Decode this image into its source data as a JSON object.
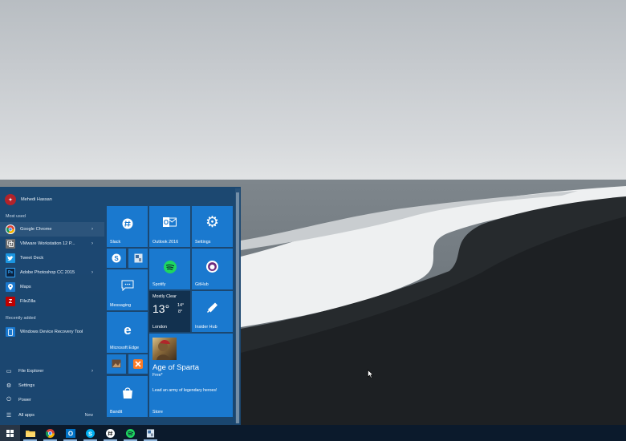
{
  "user": {
    "name": "Mehedi Hassan"
  },
  "most_used": {
    "header": "Most used",
    "items": [
      {
        "label": "Google Chrome",
        "icon": "chrome-icon",
        "has_arrow": true
      },
      {
        "label": "VMware Workstation 12 P...",
        "icon": "vmware-icon",
        "has_arrow": true
      },
      {
        "label": "Tweet Deck",
        "icon": "tweetdeck-icon",
        "has_arrow": false
      },
      {
        "label": "Adobe Photoshop CC 2015",
        "icon": "photoshop-icon",
        "has_arrow": true
      },
      {
        "label": "Maps",
        "icon": "maps-icon",
        "has_arrow": false
      },
      {
        "label": "FileZilla",
        "icon": "filezilla-icon",
        "has_arrow": false
      }
    ]
  },
  "recently_added": {
    "header": "Recently added",
    "items": [
      {
        "label": "Windows Device Recovery Tool",
        "icon": "recovery-tool-icon"
      }
    ]
  },
  "bottom": {
    "file_explorer": "File Explorer",
    "settings": "Settings",
    "power": "Power",
    "all_apps": "All apps",
    "new_badge": "New"
  },
  "tiles": {
    "slack": "Slack",
    "outlook": "Outlook 2016",
    "settings": "Settings",
    "spotify": "Spotify",
    "github": "GitHub",
    "messaging": "Messaging",
    "edge": "Microsoft Edge",
    "insider": "Insider Hub",
    "bandit": "Bandit",
    "store": "Store",
    "weather": {
      "condition": "Mostly Clear",
      "temp": "13°",
      "high": "14°",
      "low": "8°",
      "city": "London"
    },
    "age_of_sparta": {
      "title": "Age of Sparta",
      "price": "Free*",
      "tagline": "Lead an army of legendary heroes!"
    }
  },
  "colors": {
    "accent": "#1a79cf",
    "menu_bg": "#164470",
    "taskbar": "#0b1a2c"
  }
}
